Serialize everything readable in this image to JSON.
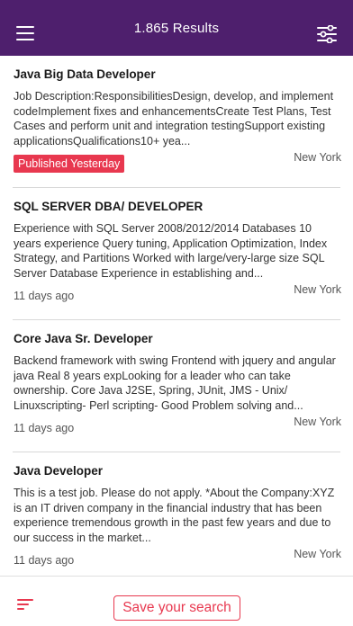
{
  "header": {
    "title": "1.865 Results",
    "menu_icon": "hamburger-menu-icon",
    "filter_icon": "sliders-filter-icon",
    "background": "#4e1f6d"
  },
  "jobs": [
    {
      "title": "Java Big Data Developer",
      "description": "Job Description:ResponsibilitiesDesign, develop, and implement codeImplement fixes and enhancementsCreate Test Plans, Test Cases and perform unit and integration testingSupport existing applicationsQualifications10+ yea...",
      "date": "Published Yesterday",
      "location": "New York"
    },
    {
      "title": "SQL SERVER DBA/ DEVELOPER",
      "description": "Experience with SQL Server 2008/2012/2014 Databases 10 years experience Query tuning, Application Optimization, Index Strategy, and Partitions Worked with large/very-large size SQL Server Database Experience in establishing and...",
      "date": "11 days ago",
      "location": "New York"
    },
    {
      "title": "Core Java Sr. Developer",
      "description": "Backend framework with swing Frontend with jquery and angular java Real 8 years expLooking for a leader who can take ownership. Core Java J2SE, Spring, JUnit, JMS - Unix/ Linuxscripting- Perl scripting- Good Problem solving and...",
      "date": "11 days ago",
      "location": "New York"
    },
    {
      "title": "Java Developer",
      "description": "This is a test job. Please do not apply. *About the Company:XYZ is an IT driven company in the financial industry that has been experience tremendous growth in the past few years and due to our success in the market...",
      "date": "11 days ago",
      "location": "New York"
    }
  ],
  "bottom": {
    "sort_icon": "sort-lines-icon",
    "save_label": "Save your search",
    "accent": "#e8384f"
  }
}
